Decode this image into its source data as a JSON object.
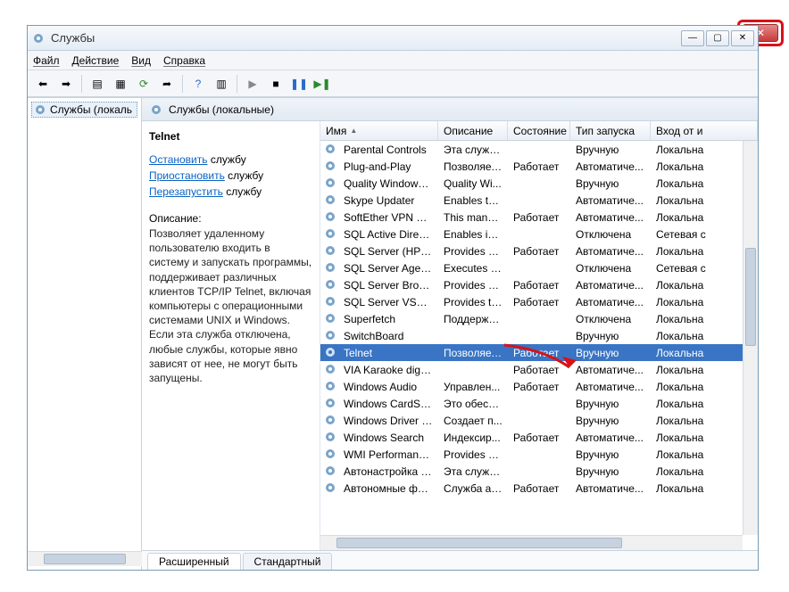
{
  "window": {
    "title": "Службы"
  },
  "menu": {
    "file": "Файл",
    "action": "Действие",
    "view": "Вид",
    "help": "Справка"
  },
  "left": {
    "node": "Службы (локаль"
  },
  "header": {
    "label": "Службы (локальные)"
  },
  "detail": {
    "name": "Telnet",
    "stop_link": "Остановить",
    "stop_rest": " службу",
    "pause_link": "Приостановить",
    "pause_rest": " службу",
    "restart_link": "Перезапустить",
    "restart_rest": " службу",
    "desc_label": "Описание:",
    "desc": "Позволяет удаленному пользователю входить в систему и запускать программы, поддерживает различных клиентов TCP/IP Telnet, включая компьютеры с операционными системами UNIX и Windows. Если эта служба отключена, любые службы, которые явно зависят от нее, не могут быть запущены."
  },
  "columns": {
    "name": "Имя",
    "desc": "Описание",
    "state": "Состояние",
    "startup": "Тип запуска",
    "logon": "Вход от и"
  },
  "services": [
    {
      "name": "Parental Controls",
      "desc": "Эта служб...",
      "state": "",
      "startup": "Вручную",
      "logon": "Локальна"
    },
    {
      "name": "Plug-and-Play",
      "desc": "Позволяет...",
      "state": "Работает",
      "startup": "Автоматиче...",
      "logon": "Локальна"
    },
    {
      "name": "Quality Windows ...",
      "desc": "Quality Wi...",
      "state": "",
      "startup": "Вручную",
      "logon": "Локальна"
    },
    {
      "name": "Skype Updater",
      "desc": "Enables th...",
      "state": "",
      "startup": "Автоматиче...",
      "logon": "Локальна"
    },
    {
      "name": "SoftEther VPN Cli...",
      "desc": "This mana...",
      "state": "Работает",
      "startup": "Автоматиче...",
      "logon": "Локальна"
    },
    {
      "name": "SQL Active Direct...",
      "desc": "Enables int...",
      "state": "",
      "startup": "Отключена",
      "logon": "Сетевая с"
    },
    {
      "name": "SQL Server (HPDS...",
      "desc": "Provides st...",
      "state": "Работает",
      "startup": "Автоматиче...",
      "logon": "Локальна"
    },
    {
      "name": "SQL Server Agent ...",
      "desc": "Executes jo...",
      "state": "",
      "startup": "Отключена",
      "logon": "Сетевая с"
    },
    {
      "name": "SQL Server Browser",
      "desc": "Provides S...",
      "state": "Работает",
      "startup": "Автоматиче...",
      "logon": "Локальна"
    },
    {
      "name": "SQL Server VSS Wr...",
      "desc": "Provides th...",
      "state": "Работает",
      "startup": "Автоматиче...",
      "logon": "Локальна"
    },
    {
      "name": "Superfetch",
      "desc": "Поддержи...",
      "state": "",
      "startup": "Отключена",
      "logon": "Локальна"
    },
    {
      "name": "SwitchBoard",
      "desc": "",
      "state": "",
      "startup": "Вручную",
      "logon": "Локальна"
    },
    {
      "name": "Telnet",
      "desc": "Позволяет...",
      "state": "Работает",
      "startup": "Вручную",
      "logon": "Локальна",
      "selected": true
    },
    {
      "name": "VIA Karaoke digita...",
      "desc": "",
      "state": "Работает",
      "startup": "Автоматиче...",
      "logon": "Локальна"
    },
    {
      "name": "Windows Audio",
      "desc": "Управлен...",
      "state": "Работает",
      "startup": "Автоматиче...",
      "logon": "Локальна"
    },
    {
      "name": "Windows CardSpa...",
      "desc": "Это обесп...",
      "state": "",
      "startup": "Вручную",
      "logon": "Локальна"
    },
    {
      "name": "Windows Driver F...",
      "desc": "Создает п...",
      "state": "",
      "startup": "Вручную",
      "logon": "Локальна"
    },
    {
      "name": "Windows Search",
      "desc": "Индексир...",
      "state": "Работает",
      "startup": "Автоматиче...",
      "logon": "Локальна"
    },
    {
      "name": "WMI Performance...",
      "desc": "Provides p...",
      "state": "",
      "startup": "Вручную",
      "logon": "Локальна"
    },
    {
      "name": "Автонастройка W...",
      "desc": "Эта служб...",
      "state": "",
      "startup": "Вручную",
      "logon": "Локальна"
    },
    {
      "name": "Автономные фай...",
      "desc": "Служба ав...",
      "state": "Работает",
      "startup": "Автоматиче...",
      "logon": "Локальна"
    }
  ],
  "tabs": {
    "ext": "Расширенный",
    "std": "Стандартный"
  }
}
